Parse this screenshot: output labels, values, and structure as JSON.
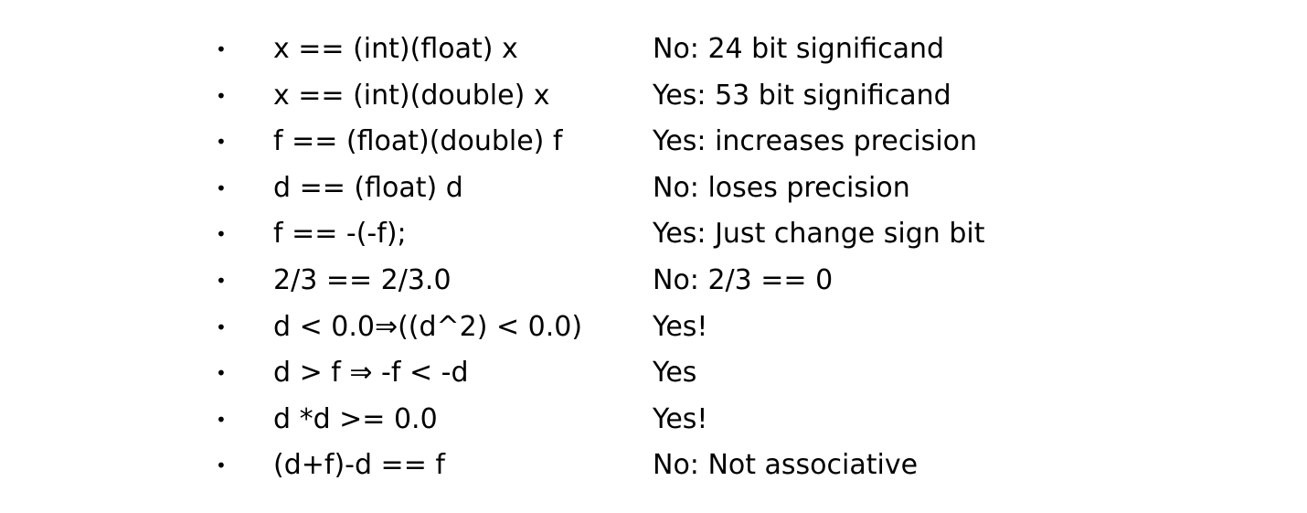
{
  "items": [
    {
      "bullet": "•",
      "expression": "x == (int)(float) x",
      "answer": "No: 24 bit significand"
    },
    {
      "bullet": "•",
      "expression": "x == (int)(double) x",
      "answer": "Yes: 53 bit significand"
    },
    {
      "bullet": "•",
      "expression": "f == (float)(double) f",
      "answer": "Yes: increases precision"
    },
    {
      "bullet": "•",
      "expression": "d == (float) d",
      "answer": "No: loses precision"
    },
    {
      "bullet": "•",
      "expression": "f == -(-f);",
      "answer": "Yes: Just change sign bit"
    },
    {
      "bullet": "•",
      "expression": "2/3 == 2/3.0",
      "answer": "No: 2/3 == 0"
    },
    {
      "bullet": "•",
      "expression": "d < 0.0⇒((d^2) < 0.0)",
      "answer": "Yes!"
    },
    {
      "bullet": "•",
      "expression": "d > f ⇒ -f < -d",
      "answer": "Yes"
    },
    {
      "bullet": "•",
      "expression": "d *d >= 0.0",
      "answer": "Yes!"
    },
    {
      "bullet": "•",
      "expression": "(d+f)-d == f",
      "answer": "No: Not associative"
    }
  ]
}
